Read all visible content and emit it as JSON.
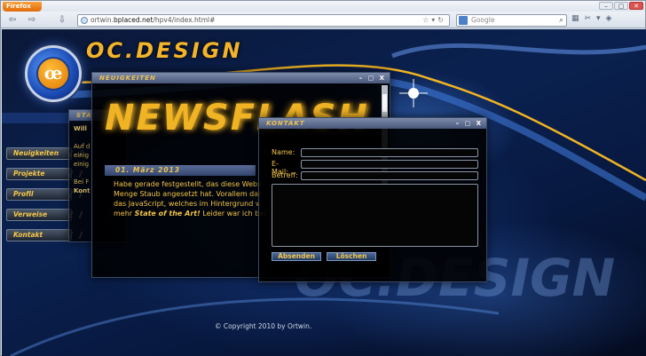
{
  "browser": {
    "menu_button": "Firefox",
    "url_domain": "bplaced.net",
    "url_pre": "ortwin.",
    "url_post": "/hpv4/index.html#",
    "search_placeholder": "Google",
    "nav_back": "⇦",
    "nav_forward": "⇨",
    "nav_download": "⇩",
    "win_min": "–",
    "win_max": "▢",
    "win_close": "✕"
  },
  "site": {
    "logo_letters": "œ",
    "title": "OC.DESIGN",
    "copyright": "© Copyright 2010 by Ortwin."
  },
  "nav": {
    "items": [
      {
        "label": "Neuigkeiten"
      },
      {
        "label": "Projekte"
      },
      {
        "label": "Profil"
      },
      {
        "label": "Verweise"
      },
      {
        "label": "Kontakt"
      }
    ]
  },
  "windows": {
    "status": {
      "title": "STA",
      "line1": "Will",
      "line2": "Auf d",
      "line3": "einig",
      "line4": "einig",
      "line5": "Bei F",
      "line6": "Kont"
    },
    "news": {
      "title": "NEUIGKEITEN",
      "banner": "NEWSFLASH",
      "date": "01. März 2013",
      "line1": "Habe gerade festgestellt, das diese Webs",
      "line2": "Menge Staub angesetzt hat. Vorallem das",
      "line3": "das JavaScript, welches im Hintergrund w",
      "line4_pre": "mehr ",
      "line4_bold": "State of the Art!",
      "line4_post": " Leider war ich bei",
      "controls": "– ▢ X"
    },
    "contact": {
      "title": "KONTAKT",
      "controls": "– ▢ X",
      "name_label": "Name:",
      "email_label": "E-Mail:",
      "subject_label": "Betreff:",
      "send_button": "Absenden",
      "clear_button": "Löschen"
    }
  }
}
